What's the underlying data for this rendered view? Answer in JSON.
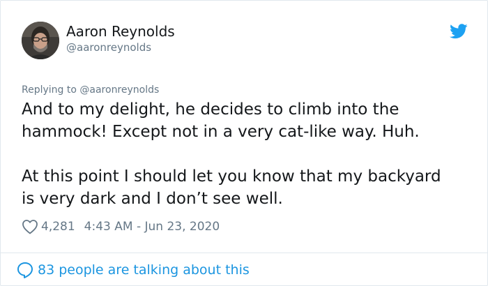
{
  "author": {
    "name": "Aaron Reynolds",
    "handle": "@aaronreynolds"
  },
  "reply_context": {
    "prefix": "Replying to",
    "mention": "@aaronreynolds"
  },
  "tweet": {
    "paragraphs": [
      "And to my delight, he decides to climb into the\nhammock! Except not in a very cat-like way. Huh.",
      "At this point I should let you know that my backyard\nis very dark and I don’t see well."
    ]
  },
  "meta": {
    "likes": "4,281",
    "timestamp": "4:43 AM - Jun 23, 2020"
  },
  "footer": {
    "conversation_label": "83 people are talking about this"
  },
  "icons": {
    "brand": "twitter-bird-icon",
    "like": "heart-outline-icon",
    "conversation": "speech-bubble-icon"
  },
  "colors": {
    "brand_blue": "#1da1f2",
    "link_blue": "#1b95e0",
    "text": "#14171a",
    "secondary_text": "#657786",
    "border": "#e1e8ed"
  }
}
